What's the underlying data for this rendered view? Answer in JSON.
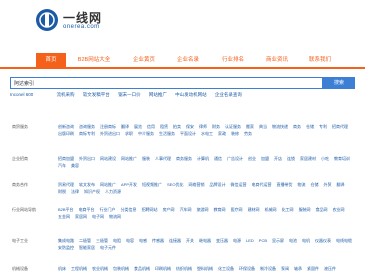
{
  "logo": {
    "title": "一线网",
    "subtitle": "onerea.com"
  },
  "nav": [
    {
      "label": "首页",
      "active": true
    },
    {
      "label": "B2B网站大全",
      "active": false
    },
    {
      "label": "企业黄页",
      "active": false
    },
    {
      "label": "企业名录",
      "active": false
    },
    {
      "label": "行业排名",
      "active": false
    },
    {
      "label": "商业资讯",
      "active": false
    },
    {
      "label": "联系我们",
      "active": false
    }
  ],
  "search": {
    "value": "阿达索引",
    "button": "搜索"
  },
  "hot_links": [
    "Inconel 600",
    "流机采购",
    "软文发稿平台",
    "锯末一口价",
    "网站推广",
    "中山发动机网站",
    "企业名录查询"
  ],
  "categories": [
    {
      "label": "商贸服务",
      "links": [
        "创新咨询",
        "咨询服务",
        "注册商标",
        "翻译",
        "展览",
        "信用",
        "租赁",
        "拍卖",
        "保安",
        "律师",
        "财务",
        "认证服务",
        "搬家",
        "典当",
        "物流快递",
        "商务",
        "仓储",
        "专利",
        "招商代理",
        "出版印刷",
        "商标专利",
        "外贸进出口",
        "求职",
        "中介服务",
        "生活服务",
        "平面设计",
        "水电工",
        "家政",
        "装修",
        "劳务"
      ]
    },
    {
      "label": "企业招商",
      "links": [
        "招商加盟",
        "外贸出口",
        "网站建设",
        "网站推广",
        "服装",
        "人事代理",
        "商务服务",
        "计算机",
        "通信",
        "广告设计",
        "创业",
        "加盟",
        "开店",
        "连锁",
        "家居建材",
        "小吃",
        "教育培训",
        "汽车",
        "美容"
      ]
    },
    {
      "label": "商务合作",
      "links": [
        "贸易代理",
        "软文发布",
        "网站推广",
        "APP开发",
        "短视频推广",
        "SEO优化",
        "网络营销",
        "品牌设计",
        "微信运营",
        "电商代运营",
        "直播带货",
        "物流",
        "仓储",
        "外贸",
        "翻译",
        "财税",
        "法律",
        "知识产权",
        "人力资源"
      ]
    },
    {
      "label": "行业网站导航",
      "links": [
        "B2B平台",
        "电商平台",
        "行业门户",
        "分类信息",
        "招聘网站",
        "房产网",
        "汽车网",
        "旅游网",
        "教育网",
        "医疗网",
        "建材网",
        "机械网",
        "化工网",
        "服装网",
        "食品网",
        "农业网",
        "五金网",
        "家居网",
        "电子网",
        "物流网"
      ]
    },
    {
      "label": "电子工业",
      "links": [
        "集成电路",
        "二极管",
        "三极管",
        "电阻",
        "电容",
        "电感",
        "传感器",
        "连接器",
        "开关",
        "继电器",
        "变压器",
        "电源",
        "LED",
        "PCB",
        "显示屏",
        "电池",
        "电机",
        "仪器仪表",
        "电线电缆",
        "安防监控",
        "智能家居",
        "电子元件"
      ]
    },
    {
      "label": "机械设备",
      "links": [
        "机床",
        "工程机械",
        "农业机械",
        "包装机械",
        "食品机械",
        "印刷机械",
        "纺织机械",
        "塑料机械",
        "化工设备",
        "环保设备",
        "制冷设备",
        "泵阀",
        "轴承",
        "紧固件",
        "液压件"
      ]
    }
  ]
}
